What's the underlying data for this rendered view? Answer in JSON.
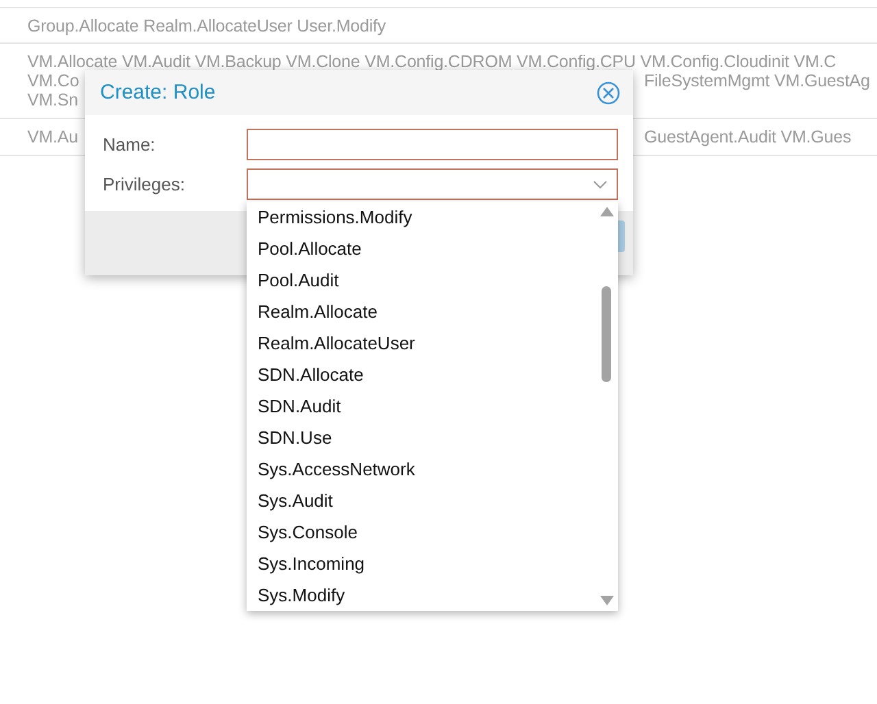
{
  "background_table": {
    "rows": [
      {
        "lines": [
          {
            "left": "Group.Allocate Realm.AllocateUser User.Modify"
          }
        ]
      },
      {
        "lines": [
          {
            "left": "VM.Allocate VM.Audit VM.Backup VM.Clone VM.Config.CDROM VM.Config.CPU VM.Config.Cloudinit VM.C"
          },
          {
            "left": "VM.Co",
            "right": "FileSystemMgmt VM.GuestAg"
          },
          {
            "left": "VM.Sn"
          }
        ]
      },
      {
        "lines": [
          {
            "left": "VM.Au",
            "right": "GuestAgent.Audit VM.Gues"
          }
        ]
      }
    ]
  },
  "dialog": {
    "title": "Create: Role",
    "fields": [
      {
        "label": "Name:",
        "kind": "text",
        "invalid": true
      },
      {
        "label": "Privileges:",
        "kind": "combo",
        "invalid": true
      }
    ],
    "dropdown": {
      "items": [
        {
          "label": "Permissions.Modify",
          "selected": false
        },
        {
          "label": "Pool.Allocate",
          "selected": false
        },
        {
          "label": "Pool.Audit",
          "selected": false
        },
        {
          "label": "Realm.Allocate",
          "selected": false
        },
        {
          "label": "Realm.AllocateUser",
          "selected": false
        },
        {
          "label": "SDN.Allocate",
          "selected": false
        },
        {
          "label": "SDN.Audit",
          "selected": false
        },
        {
          "label": "SDN.Use",
          "selected": false
        },
        {
          "label": "Sys.AccessNetwork",
          "selected": false
        },
        {
          "label": "Sys.Audit",
          "selected": false
        },
        {
          "label": "Sys.Console",
          "selected": false
        },
        {
          "label": "Sys.Incoming",
          "selected": false
        },
        {
          "label": "Sys.Modify",
          "selected": false
        }
      ]
    }
  }
}
